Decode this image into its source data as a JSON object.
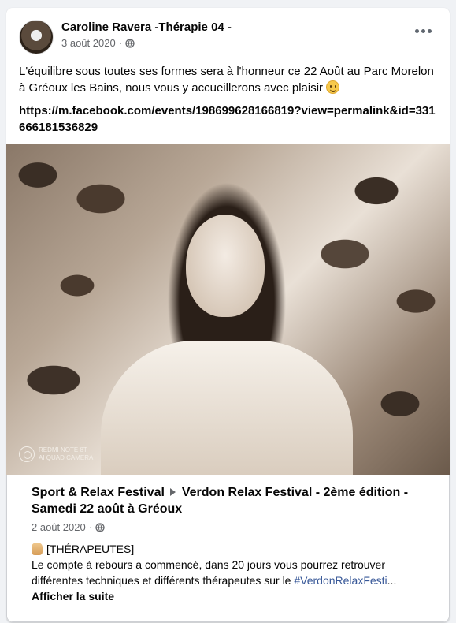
{
  "post": {
    "author": "Caroline Ravera -Thérapie 04 -",
    "date": "3 août 2020",
    "separator": "·",
    "text": "L'équilibre sous toutes ses formes sera à l'honneur ce 22 Août au Parc Morelon à Gréoux les Bains, nous vous y accueillerons avec plaisir",
    "link": "https://m.facebook.com/events/198699628166819?view=permalink&id=331666181536829",
    "photo_watermark": [
      "REDMI NOTE 8T",
      "AI QUAD CAMERA"
    ]
  },
  "shared": {
    "page": "Sport & Relax Festival",
    "title_rest": "Verdon Relax Festival - 2ème édition - Samedi 22 août à Gréoux",
    "date": "2 août 2020",
    "separator": "·",
    "tag": "[THÉRAPEUTES]",
    "text": "Le compte à rebours a commencé, dans 20 jours vous pourrez retrouver différentes techniques et différents thérapeutes sur le ",
    "hashtag": "#VerdonRelaxFesti",
    "ellipsis": "...",
    "see_more": "Afficher la suite"
  },
  "icons": {
    "globe": "globe-icon",
    "more": "more-options-icon",
    "arrow": "triangle-right-icon",
    "emoji": "slightly-smiling-face-icon",
    "hand": "raised-hand-icon"
  },
  "colors": {
    "background": "#f0f2f5",
    "card": "#ffffff",
    "secondary_text": "#65676b",
    "hashtag": "#385898"
  }
}
